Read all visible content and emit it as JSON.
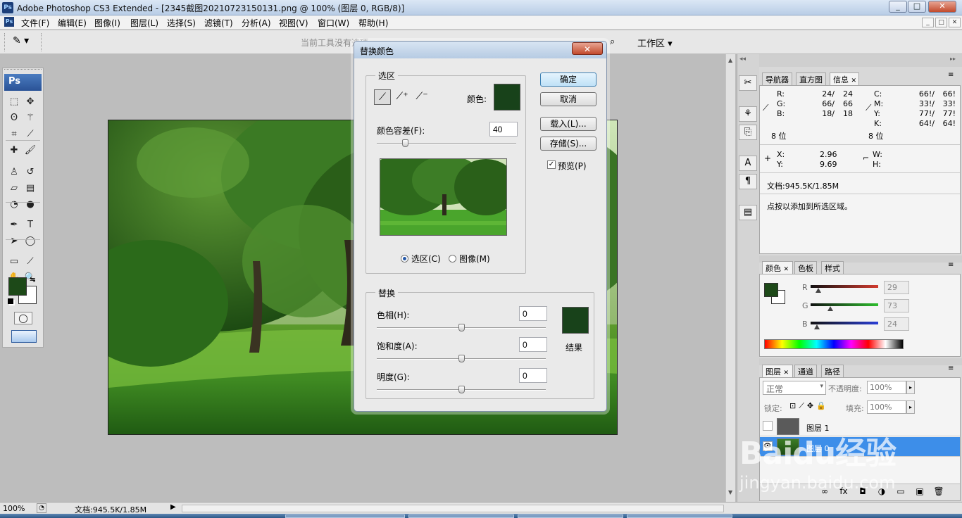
{
  "window": {
    "ps_badge": "Ps",
    "title": "Adobe Photoshop CS3 Extended - [2345截图20210723150131.png @ 100% (图层 0, RGB/8)]",
    "min": "_",
    "max": "□",
    "close": "✕",
    "doc_min": "_",
    "doc_max": "□",
    "doc_close": "✕"
  },
  "menu": {
    "items": [
      "文件(F)",
      "编辑(E)",
      "图像(I)",
      "图层(L)",
      "选择(S)",
      "滤镜(T)",
      "分析(A)",
      "视图(V)",
      "窗口(W)",
      "帮助(H)"
    ]
  },
  "options": {
    "hint": "当前工具没有选项",
    "workspace": "工作区 ▾",
    "tool_glyph": "✎ ▾"
  },
  "toolbox": {
    "logo": "Ps",
    "tools": [
      {
        "name": "marquee-tool",
        "g": "⬚"
      },
      {
        "name": "move-tool",
        "g": "✥"
      },
      {
        "name": "lasso-tool",
        "g": "ʘ"
      },
      {
        "name": "magic-wand-tool",
        "g": "⚚"
      },
      {
        "name": "crop-tool",
        "g": "⌗"
      },
      {
        "name": "slice-tool",
        "g": "⟋"
      },
      {
        "name": "healing-brush-tool",
        "g": "✚"
      },
      {
        "name": "brush-tool",
        "g": "🖌"
      },
      {
        "name": "clone-stamp-tool",
        "g": "♙"
      },
      {
        "name": "history-brush-tool",
        "g": "↺"
      },
      {
        "name": "eraser-tool",
        "g": "▱"
      },
      {
        "name": "gradient-tool",
        "g": "▤"
      },
      {
        "name": "blur-tool",
        "g": "◔"
      },
      {
        "name": "dodge-tool",
        "g": "●"
      },
      {
        "name": "pen-tool",
        "g": "✒"
      },
      {
        "name": "type-tool",
        "g": "T"
      },
      {
        "name": "path-select-tool",
        "g": "➤"
      },
      {
        "name": "ellipse-tool",
        "g": "◯"
      },
      {
        "name": "notes-tool",
        "g": "▭"
      },
      {
        "name": "eyedropper-tool",
        "g": "⟋"
      },
      {
        "name": "hand-tool",
        "g": "✋"
      },
      {
        "name": "zoom-tool",
        "g": "🔍"
      }
    ]
  },
  "dialog": {
    "title": "替换颜色",
    "close": "✕",
    "selection_group": "选区",
    "color_label": "颜色:",
    "tolerance_label": "颜色容差(F):",
    "tolerance_value": "40",
    "tolerance_fraction": 0.2,
    "radio_selection": "选区(C)",
    "radio_image": "图像(M)",
    "ok": "确定",
    "cancel": "取消",
    "load": "载入(L)...",
    "save": "存储(S)...",
    "preview": "预览(P)",
    "preview_checked": "✓",
    "replace_group": "替换",
    "hue_label": "色相(H):",
    "hue_value": "0",
    "sat_label": "饱和度(A):",
    "sat_value": "0",
    "light_label": "明度(G):",
    "light_value": "0",
    "result_label": "结果",
    "sample_color": "#18421a"
  },
  "info_panel": {
    "tabs": [
      "导航器",
      "直方图",
      "信息"
    ],
    "tab_close": "✕",
    "rgb": [
      {
        "k": "R:",
        "a": "24/",
        "b": "24"
      },
      {
        "k": "G:",
        "a": "66/",
        "b": "66"
      },
      {
        "k": "B:",
        "a": "18/",
        "b": "18"
      }
    ],
    "cmyk": [
      {
        "k": "C:",
        "a": "66!/",
        "b": "66!"
      },
      {
        "k": "M:",
        "a": "33!/",
        "b": "33!"
      },
      {
        "k": "Y:",
        "a": "77!/",
        "b": "77!"
      },
      {
        "k": "K:",
        "a": "64!/",
        "b": "64!"
      }
    ],
    "bits_left": "8 位",
    "bits_right": "8 位",
    "x_label": "X:",
    "x_value": "2.96",
    "y_label": "Y:",
    "y_value": "9.69",
    "w_label": "W:",
    "h_label": "H:",
    "doc": "文档:945.5K/1.85M",
    "hint": "点按以添加到所选区域。"
  },
  "color_panel": {
    "tabs": [
      "颜色",
      "色板",
      "样式"
    ],
    "tab_close": "✕",
    "channels": [
      {
        "k": "R",
        "v": "29",
        "fraction": 0.11,
        "color": "#d23b2f"
      },
      {
        "k": "G",
        "v": "73",
        "fraction": 0.29,
        "color": "#2dbd2d"
      },
      {
        "k": "B",
        "v": "24",
        "fraction": 0.09,
        "color": "#2b3fd6"
      }
    ],
    "fg": "#1d4918"
  },
  "layers_panel": {
    "tabs": [
      "图层",
      "通道",
      "路径"
    ],
    "tab_close": "✕",
    "blend_mode": "正常",
    "opacity_label": "不透明度:",
    "opacity_value": "100%",
    "lock_label": "锁定:",
    "fill_label": "填充:",
    "fill_value": "100%",
    "layers": [
      {
        "name": "图层 1",
        "visible": false,
        "selected": false
      },
      {
        "name": "图层 0",
        "visible": true,
        "selected": true
      }
    ],
    "bottom_icons": [
      "∞",
      "fx",
      "◘",
      "◑",
      "▭",
      "▣",
      "🗑"
    ]
  },
  "status": {
    "zoom": "100%",
    "doc": "文档:945.5K/1.85M"
  },
  "watermark": {
    "brand": "Baidu经验",
    "url": "jingyan.baidu.com"
  }
}
